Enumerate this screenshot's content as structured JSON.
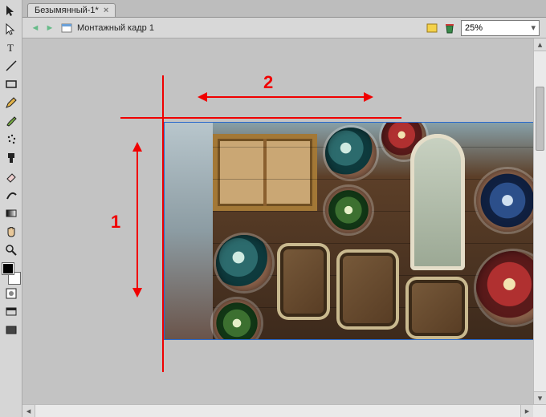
{
  "tab": {
    "title": "Безымянный-1*"
  },
  "docbar": {
    "title": "Монтажный кадр 1"
  },
  "zoom": {
    "value": "25%"
  },
  "annotations": {
    "label1": "1",
    "label2": "2"
  },
  "tools": [
    "move-tool",
    "direct-selection-tool",
    "type-tool",
    "line-tool",
    "rectangle-tool",
    "pencil-tool",
    "brush-tool",
    "spray-tool",
    "clone-tool",
    "eraser-tool",
    "smudge-tool",
    "gradient-tool",
    "hand-tool",
    "zoom-tool"
  ]
}
